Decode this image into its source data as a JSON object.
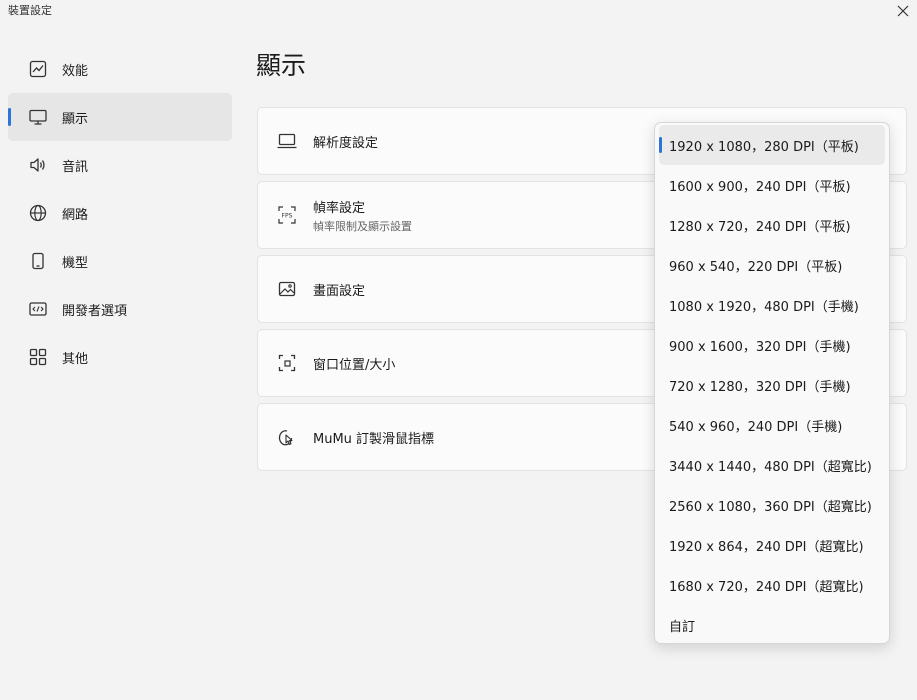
{
  "window": {
    "title": "裝置設定"
  },
  "accent_color": "#2b74d8",
  "sidebar": {
    "items": [
      {
        "label": "效能",
        "icon": "performance-chart-icon"
      },
      {
        "label": "顯示",
        "icon": "monitor-icon",
        "active": true
      },
      {
        "label": "音訊",
        "icon": "speaker-icon"
      },
      {
        "label": "網路",
        "icon": "globe-icon"
      },
      {
        "label": "機型",
        "icon": "phone-icon"
      },
      {
        "label": "開發者選項",
        "icon": "developer-icon"
      },
      {
        "label": "其他",
        "icon": "grid-icon"
      }
    ]
  },
  "main": {
    "title": "顯示",
    "cards": [
      {
        "title": "解析度設定",
        "icon": "laptop-icon"
      },
      {
        "title": "幀率設定",
        "subtitle": "幀率限制及顯示設置",
        "icon": "fps-icon",
        "icon_text": "FPS"
      },
      {
        "title": "畫面設定",
        "icon": "image-icon"
      },
      {
        "title": "窗口位置/大小",
        "icon": "window-frame-icon"
      },
      {
        "title": "MuMu 訂製滑鼠指標",
        "icon": "mouse-cursor-icon"
      }
    ]
  },
  "dropdown": {
    "selected_index": 0,
    "options": [
      "1920 x 1080，280 DPI（平板)",
      "1600 x 900，240 DPI（平板)",
      "1280 x 720，240 DPI（平板)",
      "960 x 540，220 DPI（平板)",
      "1080 x 1920，480 DPI（手機)",
      "900 x 1600，320 DPI（手機)",
      "720 x 1280，320 DPI（手機)",
      "540 x 960，240 DPI（手機)",
      "3440 x 1440，480 DPI（超寬比)",
      "2560 x 1080，360 DPI（超寬比)",
      "1920 x 864，240 DPI（超寬比)",
      "1680 x 720，240 DPI（超寬比)",
      "自訂"
    ]
  }
}
